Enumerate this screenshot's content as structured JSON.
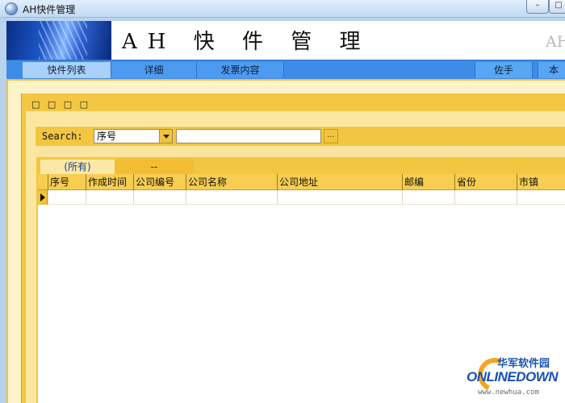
{
  "window": {
    "title": "AH快件管理",
    "min_glyph": "–",
    "max_glyph": "□"
  },
  "banner": {
    "title": "AH 快 件 管 理",
    "right_text": "AHW"
  },
  "tabs": [
    {
      "label": "快件列表",
      "active": true
    },
    {
      "label": "详细",
      "active": false
    },
    {
      "label": "发票内容",
      "active": false
    }
  ],
  "right_tabs": [
    {
      "label": "佐手"
    },
    {
      "label": "本"
    }
  ],
  "panel": {
    "header": "□ □ □ □"
  },
  "search": {
    "label": "Search:",
    "field_value": "序号",
    "text_value": "",
    "button_label": "..."
  },
  "grid": {
    "group_tabs": [
      "(所有)",
      "--"
    ],
    "columns": [
      "序号",
      "作成时间",
      "公司编号",
      "公司名称",
      "公司地址",
      "邮编",
      "省份",
      "市镇"
    ]
  },
  "watermark": {
    "cn": "华军软件园",
    "en": "ONLINEDOWN",
    "url": "www.newhua.com"
  },
  "colors": {
    "accent_blue": "#3d8ce8",
    "panel_yellow": "#f3c744",
    "header_yellow": "#f7ce52"
  }
}
